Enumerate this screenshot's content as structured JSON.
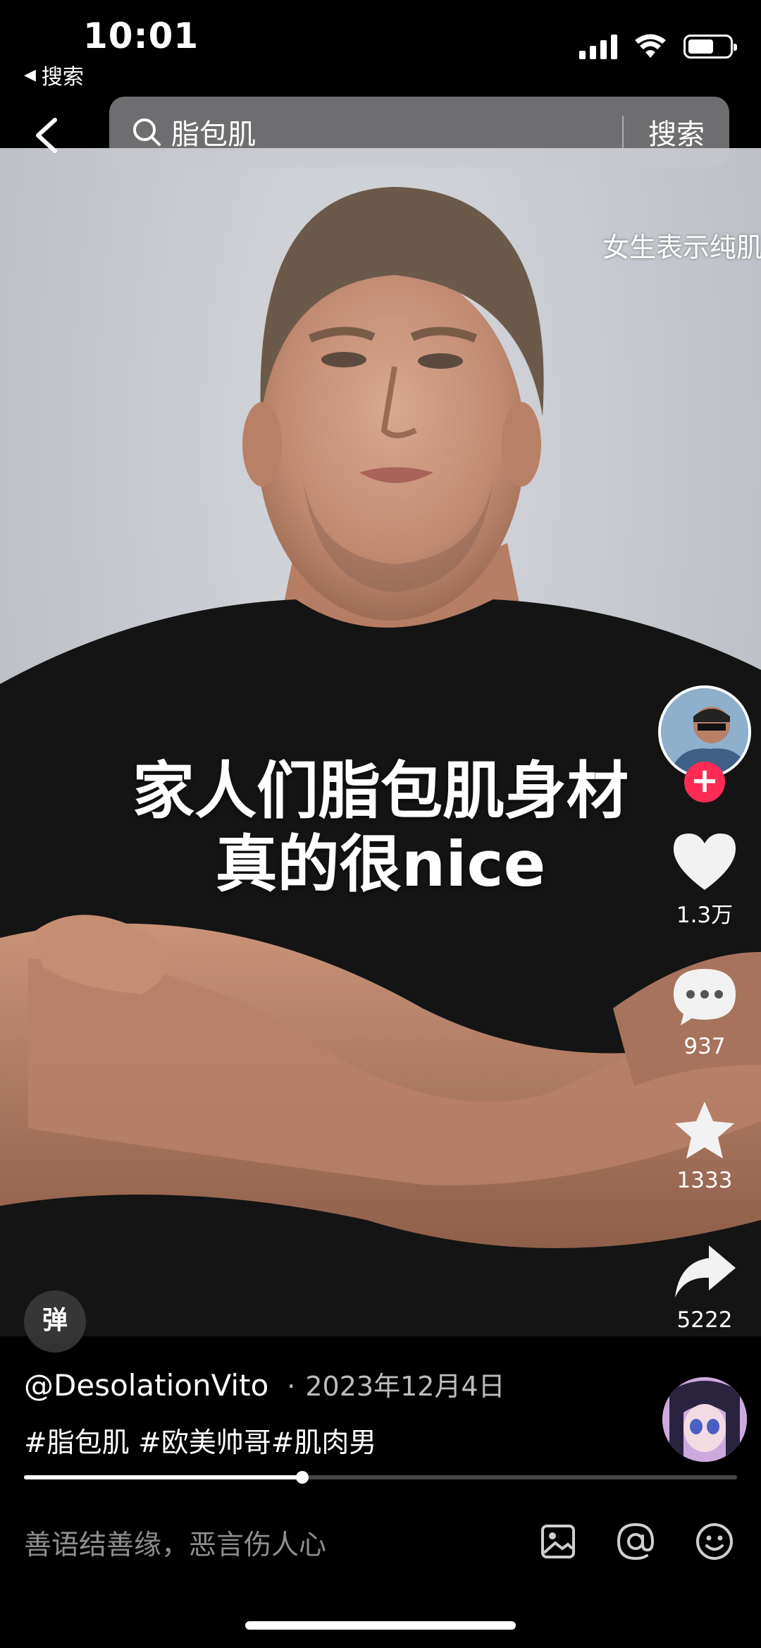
{
  "status_bar": {
    "time": "10:01",
    "back_app_label": "搜索",
    "battery_level": 0.62
  },
  "search": {
    "query": "脂包肌",
    "button_label": "搜索"
  },
  "video": {
    "side_caption": "女生表示纯肌",
    "caption_line1": "家人们脂包肌身材",
    "caption_line2": "真的很nice",
    "danmu_label": "弹"
  },
  "actions": {
    "follow_symbol": "+",
    "likes": "1.3万",
    "comments": "937",
    "favorites": "1333",
    "shares": "5222"
  },
  "post": {
    "author": "@DesolationVito",
    "separator": "·",
    "date": "2023年12月4日",
    "tags": "#脂包肌 #欧美帅哥#肌肉男",
    "progress": 0.39
  },
  "comment_bar": {
    "placeholder": "善语结善缘，恶言伤人心",
    "icons": [
      "image-icon",
      "at-icon",
      "emoji-icon"
    ]
  },
  "colors": {
    "follow_red": "#fe2c55",
    "background": "#000000",
    "secondary_text": "#bdbdbd"
  }
}
